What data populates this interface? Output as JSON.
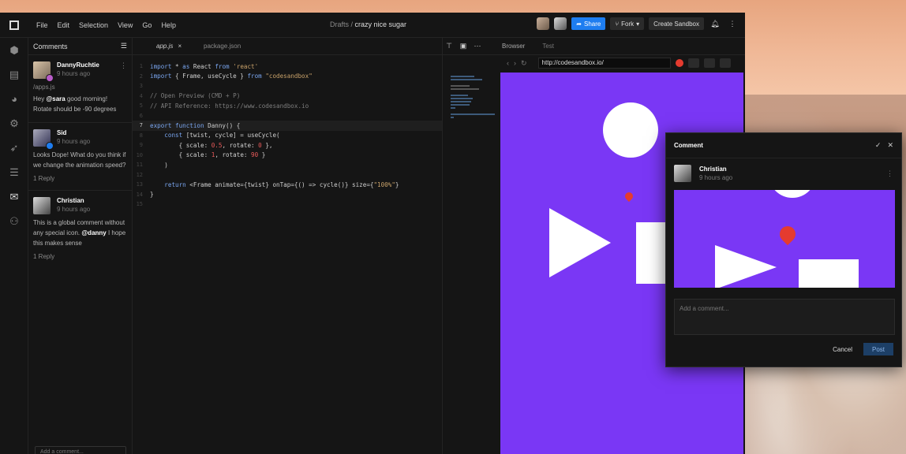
{
  "menubar": {
    "items": [
      "File",
      "Edit",
      "Selection",
      "View",
      "Go",
      "Help"
    ],
    "breadcrumb_prefix": "Drafts /",
    "project_name": "crazy nice sugar",
    "share_label": "Share",
    "fork_label": "Fork",
    "create_label": "Create Sandbox"
  },
  "comments_panel": {
    "title": "Comments",
    "add_placeholder": "Add a comment...",
    "comments": [
      {
        "author": "DannyRuchtie",
        "time": "9 hours ago",
        "file": "/apps.js",
        "body_pre": "Hey ",
        "mention": "@sara",
        "body_post": " good morning! Rotate should be -90 degrees",
        "reply": ""
      },
      {
        "author": "Sid",
        "time": "9 hours ago",
        "body": "Looks Dope! What do you think if we change the animation speed?",
        "reply": "1 Reply"
      },
      {
        "author": "Christian",
        "time": "9 hours ago",
        "body_pre": "This is a global comment without any special icon. ",
        "mention": "@danny",
        "body_post": " I hope this makes sense",
        "reply": "1 Reply"
      }
    ]
  },
  "editor": {
    "tabs": [
      "app.js",
      "package.json"
    ],
    "line_numbers": [
      "1",
      "2",
      "3",
      "4",
      "5",
      "6",
      "7",
      "8",
      "9",
      "10",
      "11",
      "12",
      "13",
      "14",
      "15"
    ]
  },
  "preview": {
    "tabs": [
      "Browser",
      "Test"
    ],
    "url": "http://codesandbox.io/"
  },
  "dialog": {
    "title": "Comment",
    "author": "Christian",
    "time": "9 hours ago",
    "input_placeholder": "Add a comment...",
    "cancel_label": "Cancel",
    "post_label": "Post"
  },
  "colors": {
    "accent": "#1e7df0",
    "canvas": "#7a37f5",
    "pin": "#e53b2f"
  }
}
